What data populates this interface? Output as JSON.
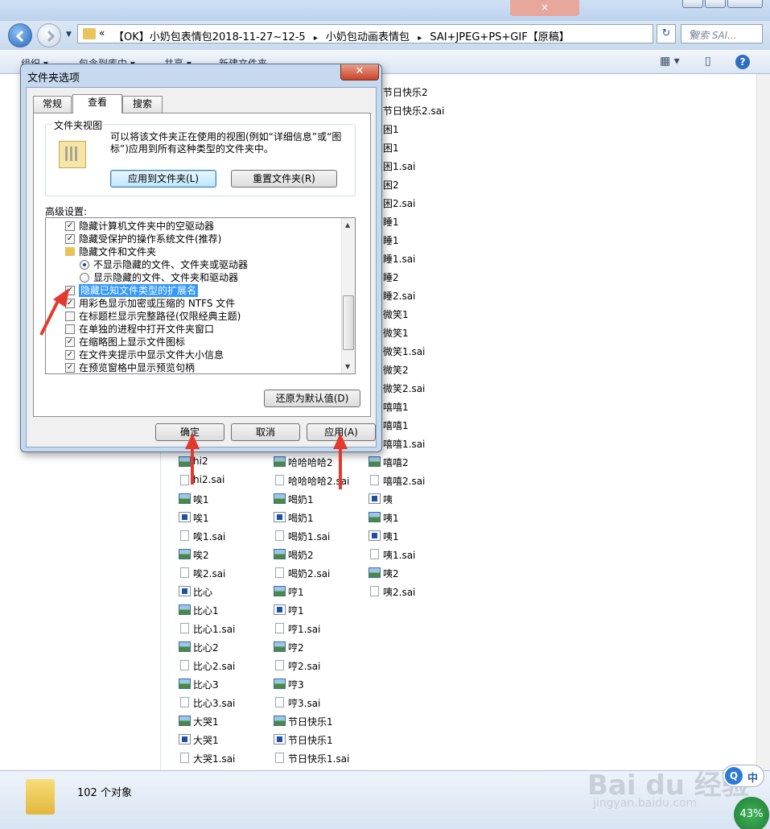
{
  "explorer": {
    "title_button": "×",
    "address_prefix": "«",
    "address_crumbs": [
      "【OK】小奶包表情包2018-11-27~12-5",
      "小奶包动画表情包",
      "SAI+JPEG+PS+GIF【原稿】"
    ],
    "address_sep": "▸",
    "search_placeholder": "搜索 SAI...",
    "toolbar": {
      "organize": "组织 ▾",
      "include": "包含到库中 ▾",
      "share": "共享 ▾",
      "new_folder": "新建文件夹"
    },
    "status_count": "102 个对象"
  },
  "files": {
    "col3_top": [
      {
        "name": "节日快乐2",
        "type": "img"
      },
      {
        "name": "节日快乐2.sai",
        "type": "sai"
      },
      {
        "name": "困1",
        "type": "img"
      },
      {
        "name": "困1",
        "type": "app"
      },
      {
        "name": "困1.sai",
        "type": "sai"
      },
      {
        "name": "困2",
        "type": "img"
      },
      {
        "name": "困2.sai",
        "type": "sai"
      },
      {
        "name": "睡1",
        "type": "img"
      },
      {
        "name": "睡1",
        "type": "app"
      },
      {
        "name": "睡1.sai",
        "type": "sai"
      },
      {
        "name": "睡2",
        "type": "img"
      },
      {
        "name": "睡2.sai",
        "type": "sai"
      },
      {
        "name": "微笑1",
        "type": "img"
      },
      {
        "name": "微笑1",
        "type": "app"
      },
      {
        "name": "微笑1.sai",
        "type": "sai"
      },
      {
        "name": "微笑2",
        "type": "img"
      },
      {
        "name": "微笑2.sai",
        "type": "sai"
      },
      {
        "name": "嘻嘻1",
        "type": "img"
      },
      {
        "name": "嘻嘻1",
        "type": "app"
      },
      {
        "name": "嘻嘻1.sai",
        "type": "sai"
      },
      {
        "name": "嘻嘻2",
        "type": "img"
      },
      {
        "name": "嘻嘻2.sai",
        "type": "sai"
      },
      {
        "name": "咦",
        "type": "app"
      },
      {
        "name": "咦1",
        "type": "img"
      },
      {
        "name": "咦1",
        "type": "app"
      },
      {
        "name": "咦1.sai",
        "type": "sai"
      },
      {
        "name": "咦2",
        "type": "img"
      },
      {
        "name": "咦2.sai",
        "type": "sai"
      }
    ],
    "col1": [
      {
        "name": "hi2",
        "type": "img"
      },
      {
        "name": "hi2.sai",
        "type": "sai"
      },
      {
        "name": "唉1",
        "type": "img"
      },
      {
        "name": "唉1",
        "type": "app"
      },
      {
        "name": "唉1.sai",
        "type": "sai"
      },
      {
        "name": "唉2",
        "type": "img"
      },
      {
        "name": "唉2.sai",
        "type": "sai"
      },
      {
        "name": "比心",
        "type": "app"
      },
      {
        "name": "比心1",
        "type": "img"
      },
      {
        "name": "比心1.sai",
        "type": "sai"
      },
      {
        "name": "比心2",
        "type": "img"
      },
      {
        "name": "比心2.sai",
        "type": "sai"
      },
      {
        "name": "比心3",
        "type": "img"
      },
      {
        "name": "比心3.sai",
        "type": "sai"
      },
      {
        "name": "大哭1",
        "type": "img"
      },
      {
        "name": "大哭1",
        "type": "app"
      },
      {
        "name": "大哭1.sai",
        "type": "sai"
      }
    ],
    "col2": [
      {
        "name": "哈哈哈哈2",
        "type": "img"
      },
      {
        "name": "哈哈哈哈2.sai",
        "type": "sai"
      },
      {
        "name": "喝奶1",
        "type": "img"
      },
      {
        "name": "喝奶1",
        "type": "app"
      },
      {
        "name": "喝奶1.sai",
        "type": "sai"
      },
      {
        "name": "喝奶2",
        "type": "img"
      },
      {
        "name": "喝奶2.sai",
        "type": "sai"
      },
      {
        "name": "哼1",
        "type": "img"
      },
      {
        "name": "哼1",
        "type": "app"
      },
      {
        "name": "哼1.sai",
        "type": "sai"
      },
      {
        "name": "哼2",
        "type": "img"
      },
      {
        "name": "哼2.sai",
        "type": "sai"
      },
      {
        "name": "哼3",
        "type": "img"
      },
      {
        "name": "哼3.sai",
        "type": "sai"
      },
      {
        "name": "节日快乐1",
        "type": "img"
      },
      {
        "name": "节日快乐1",
        "type": "app"
      },
      {
        "name": "节日快乐1.sai",
        "type": "sai"
      }
    ]
  },
  "dialog": {
    "title": "文件夹选项",
    "close": "✕",
    "tabs": [
      "常规",
      "查看",
      "搜索"
    ],
    "active_tab": "查看",
    "folder_view": {
      "label": "文件夹视图",
      "description": "可以将该文件夹正在使用的视图(例如“详细信息”或“图标”)应用到所有这种类型的文件夹中。",
      "apply_button": "应用到文件夹(L)",
      "reset_button": "重置文件夹(R)"
    },
    "advanced_label": "高级设置:",
    "advanced_items": [
      {
        "kind": "checkbox",
        "checked": true,
        "indent": 0,
        "label": "隐藏计算机文件夹中的空驱动器"
      },
      {
        "kind": "checkbox",
        "checked": true,
        "indent": 0,
        "label": "隐藏受保护的操作系统文件(推荐)"
      },
      {
        "kind": "folder",
        "checked": false,
        "indent": 0,
        "label": "隐藏文件和文件夹"
      },
      {
        "kind": "radio",
        "checked": true,
        "indent": 1,
        "label": "不显示隐藏的文件、文件夹或驱动器"
      },
      {
        "kind": "radio",
        "checked": false,
        "indent": 1,
        "label": "显示隐藏的文件、文件夹和驱动器"
      },
      {
        "kind": "checkbox",
        "checked": true,
        "indent": 0,
        "label": "隐藏已知文件类型的扩展名",
        "selected": true
      },
      {
        "kind": "checkbox",
        "checked": true,
        "indent": 0,
        "label": "用彩色显示加密或压缩的 NTFS 文件"
      },
      {
        "kind": "checkbox",
        "checked": false,
        "indent": 0,
        "label": "在标题栏显示完整路径(仅限经典主题)"
      },
      {
        "kind": "checkbox",
        "checked": false,
        "indent": 0,
        "label": "在单独的进程中打开文件夹窗口"
      },
      {
        "kind": "checkbox",
        "checked": true,
        "indent": 0,
        "label": "在缩略图上显示文件图标"
      },
      {
        "kind": "checkbox",
        "checked": true,
        "indent": 0,
        "label": "在文件夹提示中显示文件大小信息"
      },
      {
        "kind": "checkbox",
        "checked": true,
        "indent": 0,
        "label": "在预览窗格中显示预览句柄"
      }
    ],
    "restore_button": "还原为默认值(D)",
    "ok_button": "确定",
    "cancel_button": "取消",
    "apply_button": "应用(A)"
  },
  "overlay": {
    "watermark": "Bai du 经验",
    "watermark_url": "jingyan.baidu.com",
    "ime": "中",
    "badge": "43%"
  },
  "colors": {
    "selection": "#3399ff",
    "arrow": "#e23b2e",
    "dialog_frame": "#c6d9ef"
  }
}
